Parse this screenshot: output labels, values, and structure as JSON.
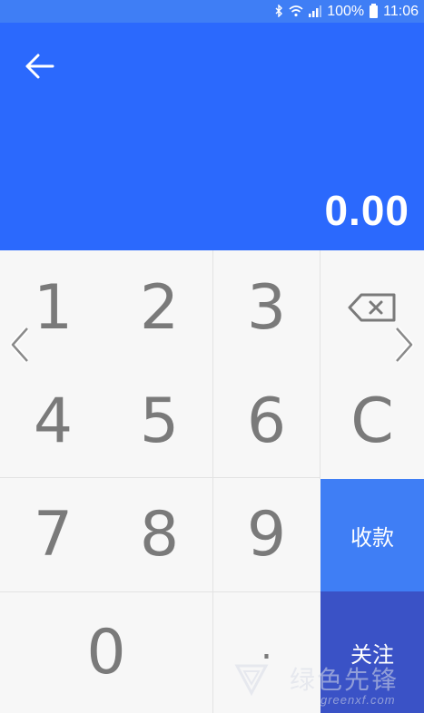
{
  "status_bar": {
    "battery": "100%",
    "time": "11:06",
    "icons": [
      "bluetooth-icon",
      "wifi-icon",
      "signal-icon",
      "battery-icon"
    ]
  },
  "header": {
    "back_icon": "arrow-left-icon",
    "amount": "0.00",
    "background": "#2b69fd"
  },
  "keypad": {
    "keys": [
      "1",
      "2",
      "3",
      "4",
      "5",
      "6",
      "7",
      "8",
      "9",
      "0",
      "."
    ],
    "backspace_icon": "backspace-icon",
    "clear": "C",
    "pay": "收款",
    "follow": "关注"
  },
  "nav": {
    "prev_icon": "chevron-left-icon",
    "next_icon": "chevron-right-icon"
  },
  "watermark": {
    "name": "绿色先锋",
    "url": "greenxf.com"
  },
  "colors": {
    "status_bar": "#3f7ef5",
    "pay_button": "#3f7ef5",
    "follow_button": "#3a52c6",
    "key_text": "#7a7a7a"
  }
}
